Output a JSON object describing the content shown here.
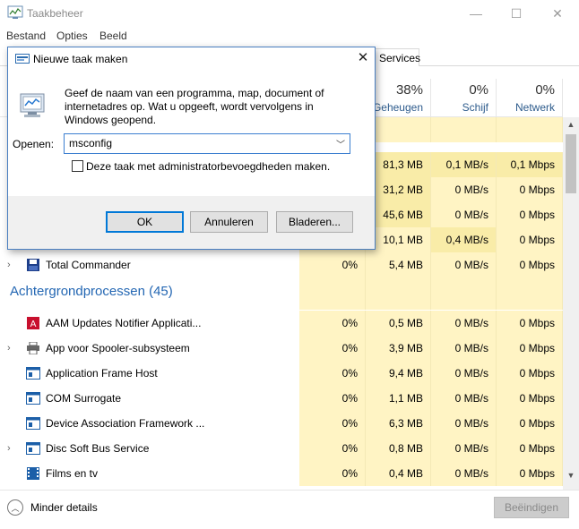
{
  "window": {
    "title": "Taakbeheer"
  },
  "menu": [
    "Bestand",
    "Opties",
    "Beeld"
  ],
  "tabs": {
    "visible_tab": "Services"
  },
  "columns": [
    {
      "pct": "",
      "label": ""
    },
    {
      "pct": "38%",
      "label": "Geheugen"
    },
    {
      "pct": "0%",
      "label": "Schijf"
    },
    {
      "pct": "0%",
      "label": "Netwerk"
    }
  ],
  "rows_top": [
    {
      "cpu": "",
      "mem": "81,3 MB",
      "disk": "0,1 MB/s",
      "net": "0,1 Mbps"
    },
    {
      "cpu": "",
      "mem": "31,2 MB",
      "disk": "0 MB/s",
      "net": "0 Mbps"
    },
    {
      "cpu": "",
      "mem": "45,6 MB",
      "disk": "0 MB/s",
      "net": "0 Mbps"
    },
    {
      "cpu": "",
      "mem": "10,1 MB",
      "disk": "0,4 MB/s",
      "net": "0 Mbps"
    },
    {
      "name": "Total Commander",
      "cpu": "0%",
      "mem": "5,4 MB",
      "disk": "0 MB/s",
      "net": "0 Mbps"
    }
  ],
  "group": {
    "title": "Achtergrondprocessen (45)"
  },
  "rows_bg": [
    {
      "name": "AAM Updates Notifier Applicati...",
      "cpu": "0%",
      "mem": "0,5 MB",
      "disk": "0 MB/s",
      "net": "0 Mbps"
    },
    {
      "name": "App voor Spooler-subsysteem",
      "cpu": "0%",
      "mem": "3,9 MB",
      "disk": "0 MB/s",
      "net": "0 Mbps"
    },
    {
      "name": "Application Frame Host",
      "cpu": "0%",
      "mem": "9,4 MB",
      "disk": "0 MB/s",
      "net": "0 Mbps"
    },
    {
      "name": "COM Surrogate",
      "cpu": "0%",
      "mem": "1,1 MB",
      "disk": "0 MB/s",
      "net": "0 Mbps"
    },
    {
      "name": "Device Association Framework ...",
      "cpu": "0%",
      "mem": "6,3 MB",
      "disk": "0 MB/s",
      "net": "0 Mbps"
    },
    {
      "name": "Disc Soft Bus Service",
      "cpu": "0%",
      "mem": "0,8 MB",
      "disk": "0 MB/s",
      "net": "0 Mbps"
    },
    {
      "name": "Films en tv",
      "cpu": "0%",
      "mem": "0,4 MB",
      "disk": "0 MB/s",
      "net": "0 Mbps"
    }
  ],
  "footer": {
    "less_details": "Minder details",
    "end_task": "Beëindigen"
  },
  "dialog": {
    "title": "Nieuwe taak maken",
    "description": "Geef de naam van een programma, map, document of internetadres op. Wat u opgeeft, wordt vervolgens in Windows geopend.",
    "open_label": "Openen:",
    "open_value": "msconfig",
    "admin_label": "Deze taak met administratorbevoegdheden maken.",
    "ok": "OK",
    "cancel": "Annuleren",
    "browse": "Bladeren..."
  }
}
